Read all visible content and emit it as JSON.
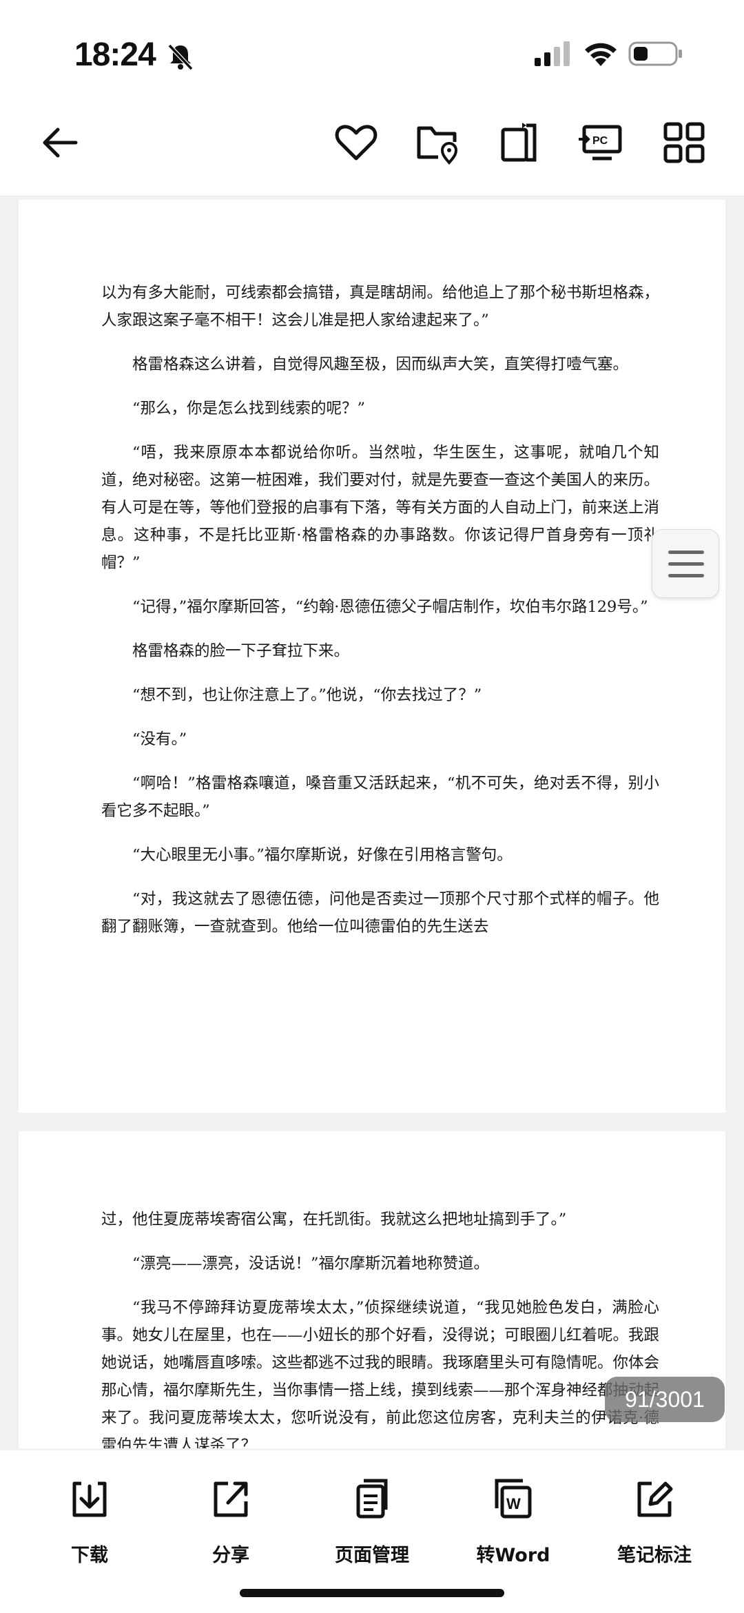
{
  "status_bar": {
    "time": "18:24"
  },
  "page1": {
    "paragraphs": [
      "以为有多大能耐，可线索都会搞错，真是瞎胡闹。给他追上了那个秘书斯坦格森，人家跟这案子毫不相干！这会儿准是把人家给逮起来了。”",
      "格雷格森这么讲着，自觉得风趣至极，因而纵声大笑，直笑得打噎气塞。",
      "“那么，你是怎么找到线索的呢？”",
      "“唔，我来原原本本都说给你听。当然啦，华生医生，这事呢，就咱几个知道，绝对秘密。这第一桩困难，我们要对付，就是先要查一查这个美国人的来历。有人可是在等，等他们登报的启事有下落，等有关方面的人自动上门，前来送上消息。这种事，不是托比亚斯·格雷格森的办事路数。你该记得尸首身旁有一顶礼帽？”",
      "“记得，”福尔摩斯回答，“约翰·恩德伍德父子帽店制作，坎伯韦尔路129号。”",
      "格雷格森的脸一下子耷拉下来。",
      "“想不到，也让你注意上了。”他说，“你去找过了？”",
      "“没有。”",
      "“啊哈！”格雷格森嚷道，嗓音重又活跃起来，“机不可失，绝对丢不得，别小看它多不起眼。”",
      "“大心眼里无小事。”福尔摩斯说，好像在引用格言警句。",
      "“对，我这就去了恩德伍德，问他是否卖过一顶那个尺寸那个式样的帽子。他翻了翻账簿，一查就查到。他给一位叫德雷伯的先生送去"
    ]
  },
  "page2": {
    "paragraphs": [
      "过，他住夏庞蒂埃寄宿公寓，在托凯街。我就这么把地址搞到手了。”",
      "“漂亮——漂亮，没话说！”福尔摩斯沉着地称赞道。",
      "“我马不停蹄拜访夏庞蒂埃太太，”侦探继续说道，“我见她脸色发白，满脸心事。她女儿在屋里，也在——小妞长的那个好看，没得说；可眼圈儿红着呢。我跟她说话，她嘴唇直哆嗦。这些都逃不过我的眼睛。我琢磨里头可有隐情呢。你体会那心情，福尔摩斯先生，当你事情一搭上线，摸到线索——那个浑身神经都抽动起来了。我问夏庞蒂埃太太，您听说没有，前此您这位房客，克利夫兰的伊诺克·德雷伯先生遭人谋杀了？"
    ]
  },
  "page_counter": "91/3001",
  "bottom_bar": {
    "download": "下载",
    "share": "分享",
    "page_manage": "页面管理",
    "to_word": "转Word",
    "notes": "笔记标注"
  },
  "icons": {
    "back": "back-arrow-icon",
    "favorite": "heart-icon",
    "location_folder": "folder-location-icon",
    "document_crop": "document-icon",
    "to_pc": "pc-transfer-icon",
    "grid": "grid-icon"
  }
}
